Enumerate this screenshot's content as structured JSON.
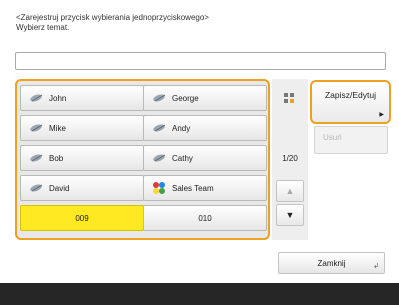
{
  "header": {
    "line1": "<Zarejestruj przycisk wybierania jednoprzyciskowego>",
    "line2": "Wybierz temat."
  },
  "entry": {
    "value": ""
  },
  "buttons": [
    {
      "label": "John",
      "icon": "contact-icon"
    },
    {
      "label": "George",
      "icon": "contact-icon"
    },
    {
      "label": "Mike",
      "icon": "contact-icon"
    },
    {
      "label": "Andy",
      "icon": "contact-icon"
    },
    {
      "label": "Bob",
      "icon": "contact-icon"
    },
    {
      "label": "Cathy",
      "icon": "contact-icon"
    },
    {
      "label": "David",
      "icon": "contact-icon"
    },
    {
      "label": "Sales Team",
      "icon": "group-icon"
    },
    {
      "label": "009"
    },
    {
      "label": "010"
    }
  ],
  "pager": {
    "indicator": "1/20",
    "up": "▲",
    "down": "▼"
  },
  "actions": {
    "save_edit": "Zapisz/Edytuj",
    "delete": "Usuń"
  },
  "footer": {
    "close": "Zamknij"
  },
  "colors": {
    "selected": "#ffe923",
    "highlight_border": "#f0a020",
    "footer_bar": "#262626"
  }
}
